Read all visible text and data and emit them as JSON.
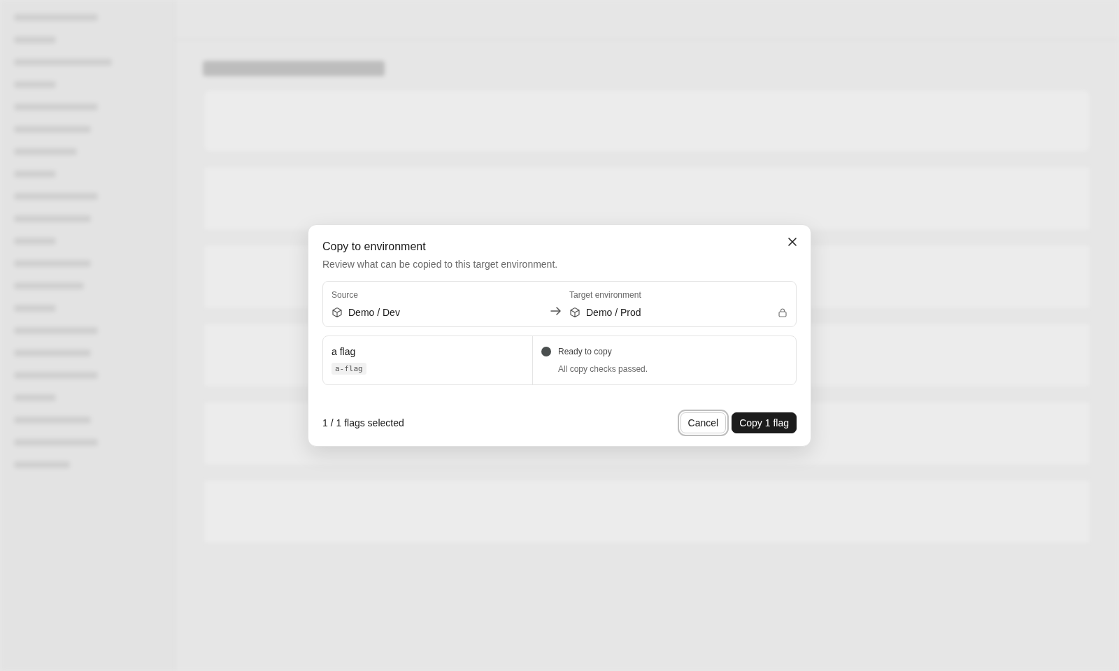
{
  "dialog": {
    "title": "Copy to environment",
    "subtitle": "Review what can be copied to this target environment.",
    "source": {
      "label": "Source",
      "value": "Demo / Dev"
    },
    "target": {
      "label": "Target environment",
      "value": "Demo / Prod",
      "locked": true
    },
    "flags": [
      {
        "name": "a flag",
        "key": "a-flag",
        "status": {
          "kind": "ready",
          "label": "Ready to copy",
          "detail": "All copy checks passed."
        }
      }
    ],
    "selection_summary": "1 / 1 flags selected",
    "buttons": [
      {
        "label": "Cancel",
        "kind": "secondary",
        "focused": true
      },
      {
        "label": "Copy 1 flag",
        "kind": "primary",
        "focused": false
      }
    ]
  }
}
